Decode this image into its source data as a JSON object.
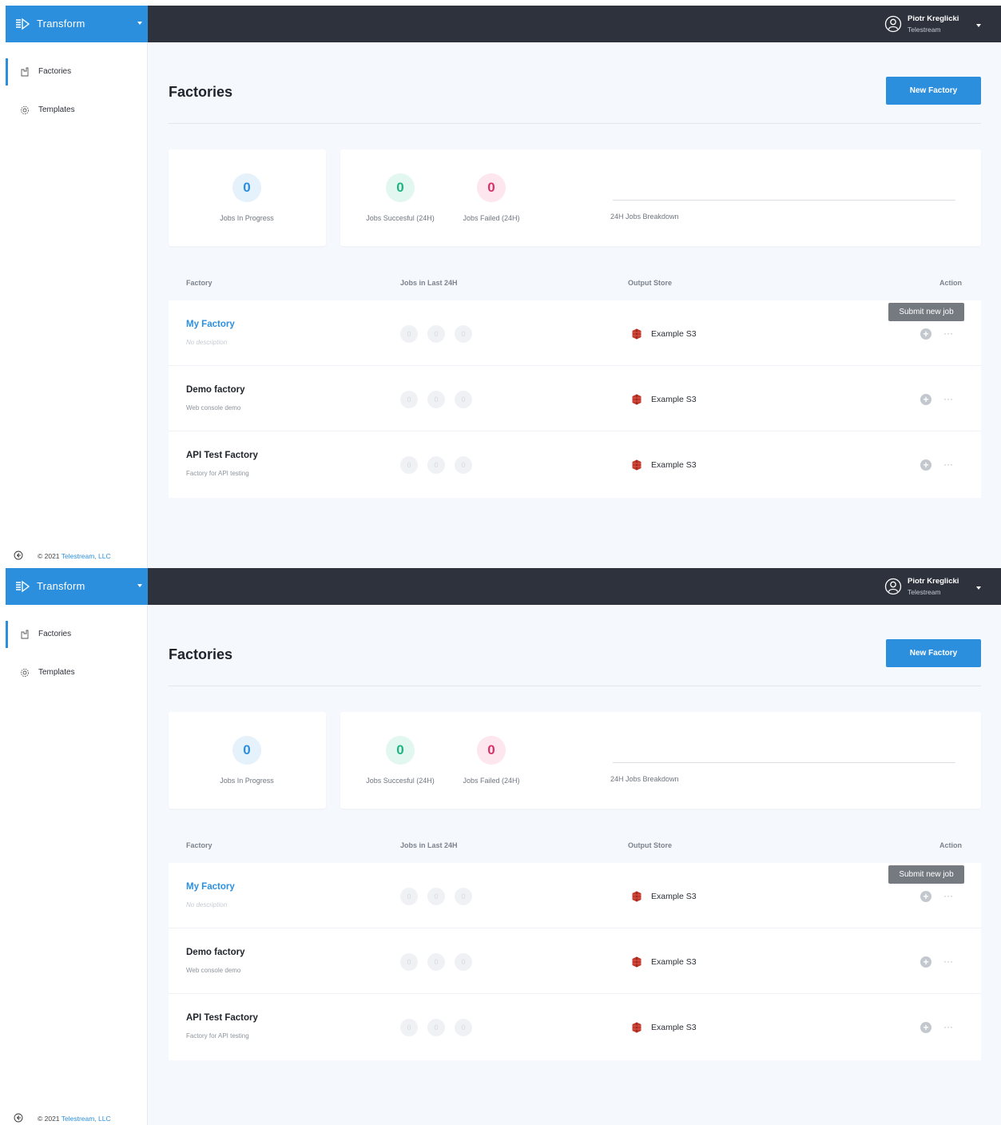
{
  "app": {
    "brand": "Transform",
    "brand_color": "#2c8fde",
    "topbar_color": "#2d323d"
  },
  "user": {
    "name": "Piotr Kreglicki",
    "org": "Telestream"
  },
  "sidebar": {
    "items": [
      {
        "label": "Factories",
        "icon": "factory-icon",
        "active": true
      },
      {
        "label": "Templates",
        "icon": "gear-icon",
        "active": false
      }
    ],
    "footer_prefix": "© 2021",
    "footer_link": "Telestream, LLC"
  },
  "page": {
    "title": "Factories",
    "new_button": "New Factory"
  },
  "stats": {
    "in_progress": {
      "value": "0",
      "label": "Jobs In Progress"
    },
    "succeeded": {
      "value": "0",
      "label": "Jobs Succesful (24H)"
    },
    "failed": {
      "value": "0",
      "label": "Jobs Failed (24H)"
    },
    "breakdown_label": "24H Jobs Breakdown"
  },
  "table": {
    "headers": {
      "factory": "Factory",
      "jobs": "Jobs in Last 24H",
      "store": "Output Store",
      "action": "Action"
    },
    "rows": [
      {
        "name": "My Factory",
        "description": "No description",
        "jobs": [
          "0",
          "0",
          "0"
        ],
        "store": "Example S3"
      },
      {
        "name": "Demo factory",
        "description": "Web console demo",
        "jobs": [
          "0",
          "0",
          "0"
        ],
        "store": "Example S3"
      },
      {
        "name": "API Test Factory",
        "description": "Factory for API testing",
        "jobs": [
          "0",
          "0",
          "0"
        ],
        "store": "Example S3"
      }
    ],
    "tooltip": "Submit new job",
    "more_glyph": "···"
  }
}
